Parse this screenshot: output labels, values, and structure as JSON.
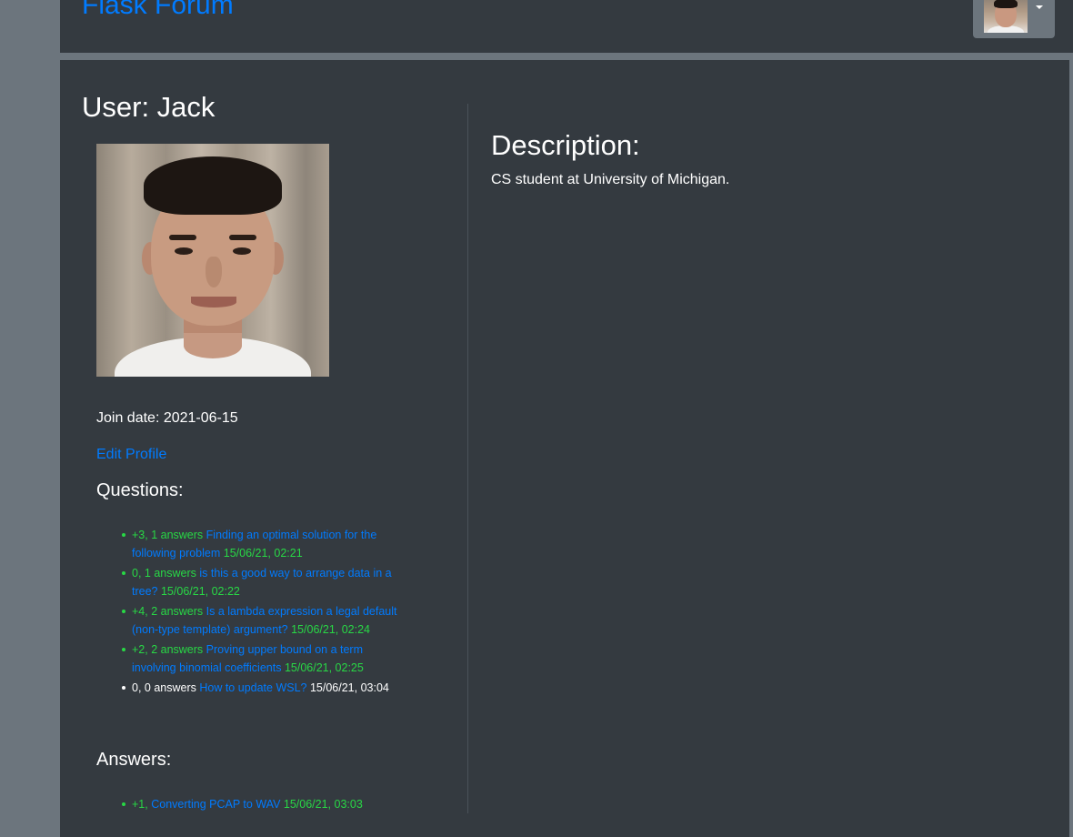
{
  "navbar": {
    "brand": "Flask Forum",
    "avatar_alt": "user-avatar"
  },
  "profile": {
    "title": "User: Jack",
    "join_date": "Join date: 2021-06-15",
    "edit_label": "Edit Profile"
  },
  "questions": {
    "title": "Questions:",
    "items": [
      {
        "score": "+3, 1 answers",
        "title": "Finding an optimal solution for the following problem",
        "date": "15/06/21, 02:21",
        "status": "answered"
      },
      {
        "score": "0, 1 answers",
        "title": "is this a good way to arrange data in a tree?",
        "date": "15/06/21, 02:22",
        "status": "answered"
      },
      {
        "score": "+4, 2 answers",
        "title": "Is a lambda expression a legal default (non-type template) argument?",
        "date": "15/06/21, 02:24",
        "status": "answered"
      },
      {
        "score": "+2, 2 answers",
        "title": "Proving upper bound on a term involving binomial coefficients",
        "date": "15/06/21, 02:25",
        "status": "answered"
      },
      {
        "score": "0, 0 answers",
        "title": "How to update WSL?",
        "date": "15/06/21, 03:04",
        "status": "unanswered"
      }
    ]
  },
  "answers": {
    "title": "Answers:",
    "items": [
      {
        "score": "+1,",
        "title": "Converting PCAP to WAV",
        "date": "15/06/21, 03:03",
        "status": "answered"
      }
    ]
  },
  "description": {
    "title": "Description:",
    "text": "CS student at University of Michigan."
  },
  "colors": {
    "background": "#6c757d",
    "panel": "#343a40",
    "link": "#007bff",
    "positive": "#28d845",
    "text": "#ffffff"
  }
}
